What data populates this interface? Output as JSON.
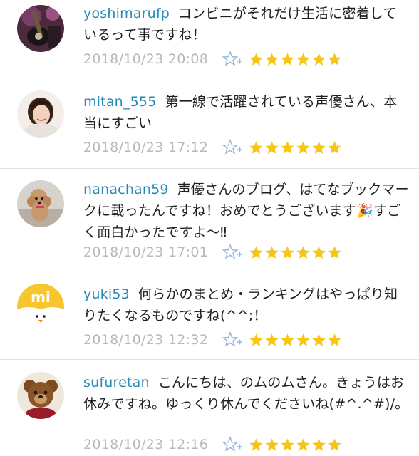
{
  "comments": [
    {
      "username": "yoshimarufp",
      "text": "コンビニがそれだけ生活に密着しているって事ですね！",
      "date": "2018/10/23 20:08",
      "star_count": 6,
      "avatar": "guitar-photo"
    },
    {
      "username": "mitan_555",
      "text": "第一線で活躍されている声優さん、本当にすごい",
      "date": "2018/10/23 17:12",
      "star_count": 6,
      "avatar": "woman-portrait"
    },
    {
      "username": "nanachan59",
      "text": "声優さんのブログ、はてなブックマークに載ったんですね！おめでとうございます🎉すごく面白かったですよ〜‼",
      "date": "2018/10/23 17:01",
      "star_count": 6,
      "avatar": "poodle-dog"
    },
    {
      "username": "yuki53",
      "text": "何らかのまとめ・ランキングはやっぱり知りたくなるものですね(^^;！",
      "date": "2018/10/23 12:32",
      "star_count": 6,
      "avatar": "mi-logo-bird"
    },
    {
      "username": "sufuretan",
      "text": "こんにちは、のムのムさん。きょうはお休みですね。ゆっくり休んでくださいね(#^.^#)/。",
      "date": "2018/10/23 12:16",
      "star_count": 6,
      "avatar": "teddy-bear"
    }
  ],
  "colors": {
    "username": "#2a8ab8",
    "date": "#b9b9b9",
    "star": "#f5c518",
    "add_star": "#9ab8d8",
    "divider": "#e3e3e3"
  },
  "icons": {
    "add_star": "add-star-icon",
    "star": "star-icon"
  }
}
